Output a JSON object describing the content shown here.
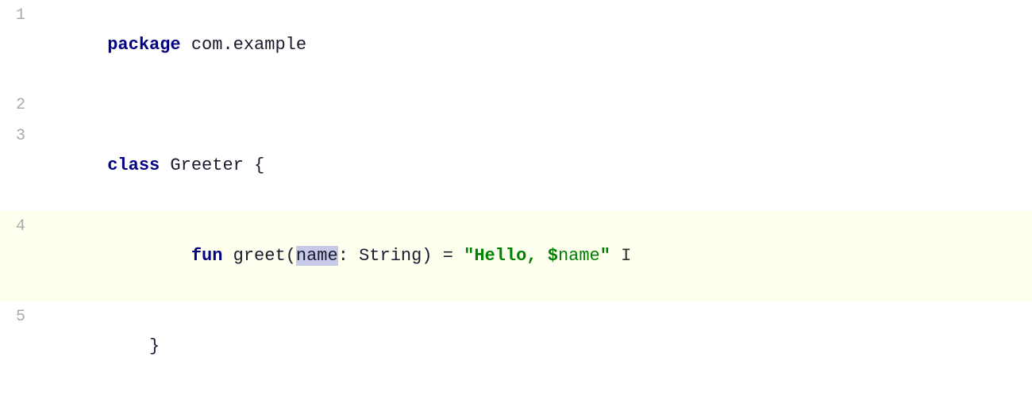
{
  "editor": {
    "background": "#ffffff",
    "active_line_background": "#fffff0",
    "lines": [
      {
        "number": "1",
        "active": false,
        "tokens": [
          {
            "type": "kw-package",
            "text": "package"
          },
          {
            "type": "text-normal",
            "text": " com.example"
          }
        ]
      },
      {
        "number": "2",
        "active": false,
        "tokens": []
      },
      {
        "number": "3",
        "active": false,
        "tokens": [
          {
            "type": "kw-class",
            "text": "class"
          },
          {
            "type": "text-normal",
            "text": " Greeter {"
          }
        ]
      },
      {
        "number": "4",
        "active": true,
        "tokens": [
          {
            "type": "indent",
            "text": "        "
          },
          {
            "type": "kw-fun",
            "text": "fun"
          },
          {
            "type": "text-normal",
            "text": " greet("
          },
          {
            "type": "highlight-name",
            "text": "name"
          },
          {
            "type": "text-normal",
            "text": ": String) = "
          },
          {
            "type": "text-string",
            "text": "\"Hello, $"
          },
          {
            "type": "text-string-var",
            "text": "name"
          },
          {
            "type": "text-string",
            "text": "\""
          },
          {
            "type": "cursor",
            "text": " I"
          }
        ]
      },
      {
        "number": "5",
        "active": false,
        "tokens": [
          {
            "type": "text-normal",
            "text": "    }"
          }
        ]
      }
    ]
  }
}
